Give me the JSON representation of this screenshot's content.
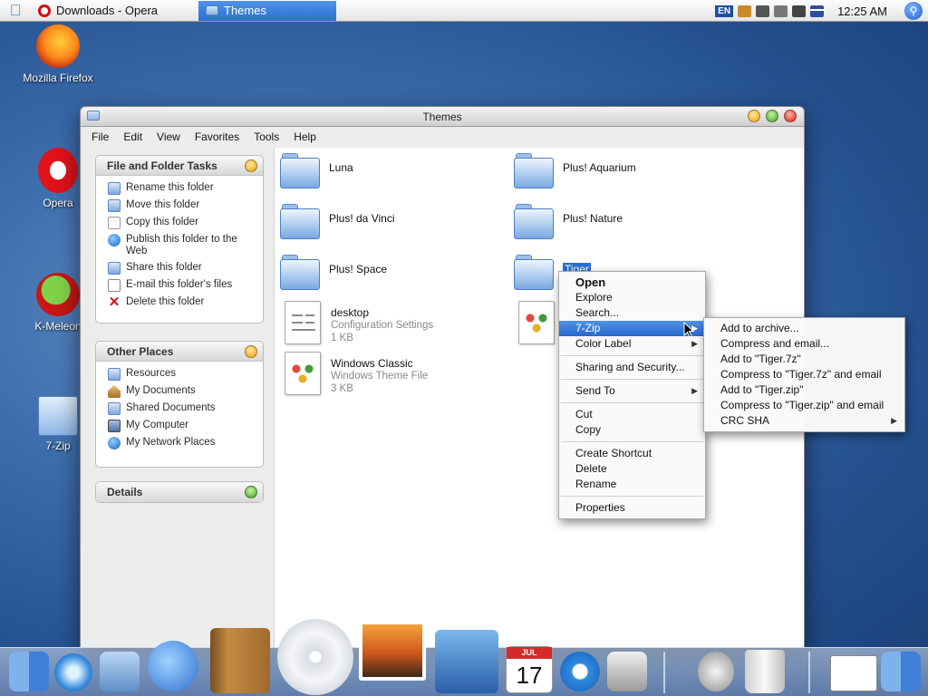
{
  "topbar": {
    "tasks": [
      {
        "label": "Downloads - Opera"
      },
      {
        "label": "Themes"
      }
    ],
    "language": "EN",
    "clock": "12:25 AM"
  },
  "desktop": {
    "icons": [
      {
        "label": "Mozilla Firefox"
      },
      {
        "label": "Opera"
      },
      {
        "label": "K-Meleon"
      },
      {
        "label": "7-Zip"
      }
    ]
  },
  "window": {
    "title": "Themes",
    "menu": [
      "File",
      "Edit",
      "View",
      "Favorites",
      "Tools",
      "Help"
    ],
    "panels": {
      "tasks": {
        "title": "File and Folder Tasks",
        "items": [
          "Rename this folder",
          "Move this folder",
          "Copy this folder",
          "Publish this folder to the Web",
          "Share this folder",
          "E-mail this folder's files",
          "Delete this folder"
        ]
      },
      "places": {
        "title": "Other Places",
        "items": [
          "Resources",
          "My Documents",
          "Shared Documents",
          "My Computer",
          "My Network Places"
        ]
      },
      "details": {
        "title": "Details"
      }
    },
    "files": [
      {
        "name": "Luna"
      },
      {
        "name": "Plus! Aquarium"
      },
      {
        "name": "Plus! da Vinci"
      },
      {
        "name": "Plus! Nature"
      },
      {
        "name": "Plus! Space"
      },
      {
        "name": "Tiger"
      },
      {
        "name": "desktop",
        "type": "Configuration Settings",
        "size": "1 KB"
      },
      {
        "name": "Windows Classic",
        "type": "Windows Theme File",
        "size": "3 KB"
      }
    ]
  },
  "context_menu": {
    "items": [
      "Open",
      "Explore",
      "Search...",
      "7-Zip",
      "Color Label",
      "Sharing and Security...",
      "Send To",
      "Cut",
      "Copy",
      "Create Shortcut",
      "Delete",
      "Rename",
      "Properties"
    ],
    "highlighted": "7-Zip"
  },
  "submenu_7zip": {
    "items": [
      "Add to archive...",
      "Compress and email...",
      "Add to \"Tiger.7z\"",
      "Compress to \"Tiger.7z\" and email",
      "Add to \"Tiger.zip\"",
      "Compress to \"Tiger.zip\" and email",
      "CRC SHA"
    ]
  },
  "dock": {
    "calendar_day": "17",
    "calendar_month": "JUL"
  },
  "colors": {
    "highlight": "#2b6fd2",
    "desktop": "#3e6eae"
  }
}
